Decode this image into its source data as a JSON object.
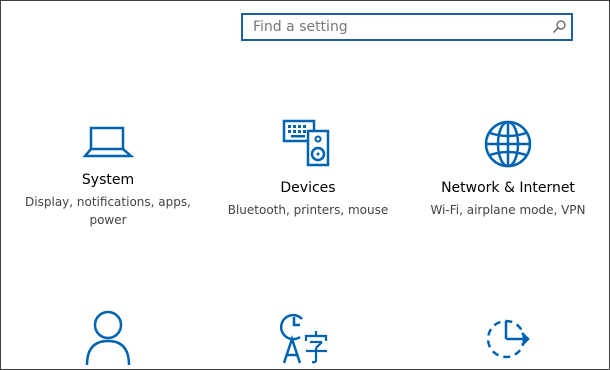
{
  "search": {
    "placeholder": "Find a setting",
    "icon": "search-icon"
  },
  "accent_color": "#0063b1",
  "tiles": [
    {
      "title": "System",
      "description": "Display, notifications, apps, power",
      "icon": "laptop-icon"
    },
    {
      "title": "Devices",
      "description": "Bluetooth, printers, mouse",
      "icon": "keyboard-speaker-icon"
    },
    {
      "title": "Network & Internet",
      "description": "Wi-Fi, airplane mode, VPN",
      "icon": "globe-icon"
    },
    {
      "icon": "person-icon"
    },
    {
      "icon": "time-language-icon"
    },
    {
      "icon": "update-icon"
    }
  ]
}
